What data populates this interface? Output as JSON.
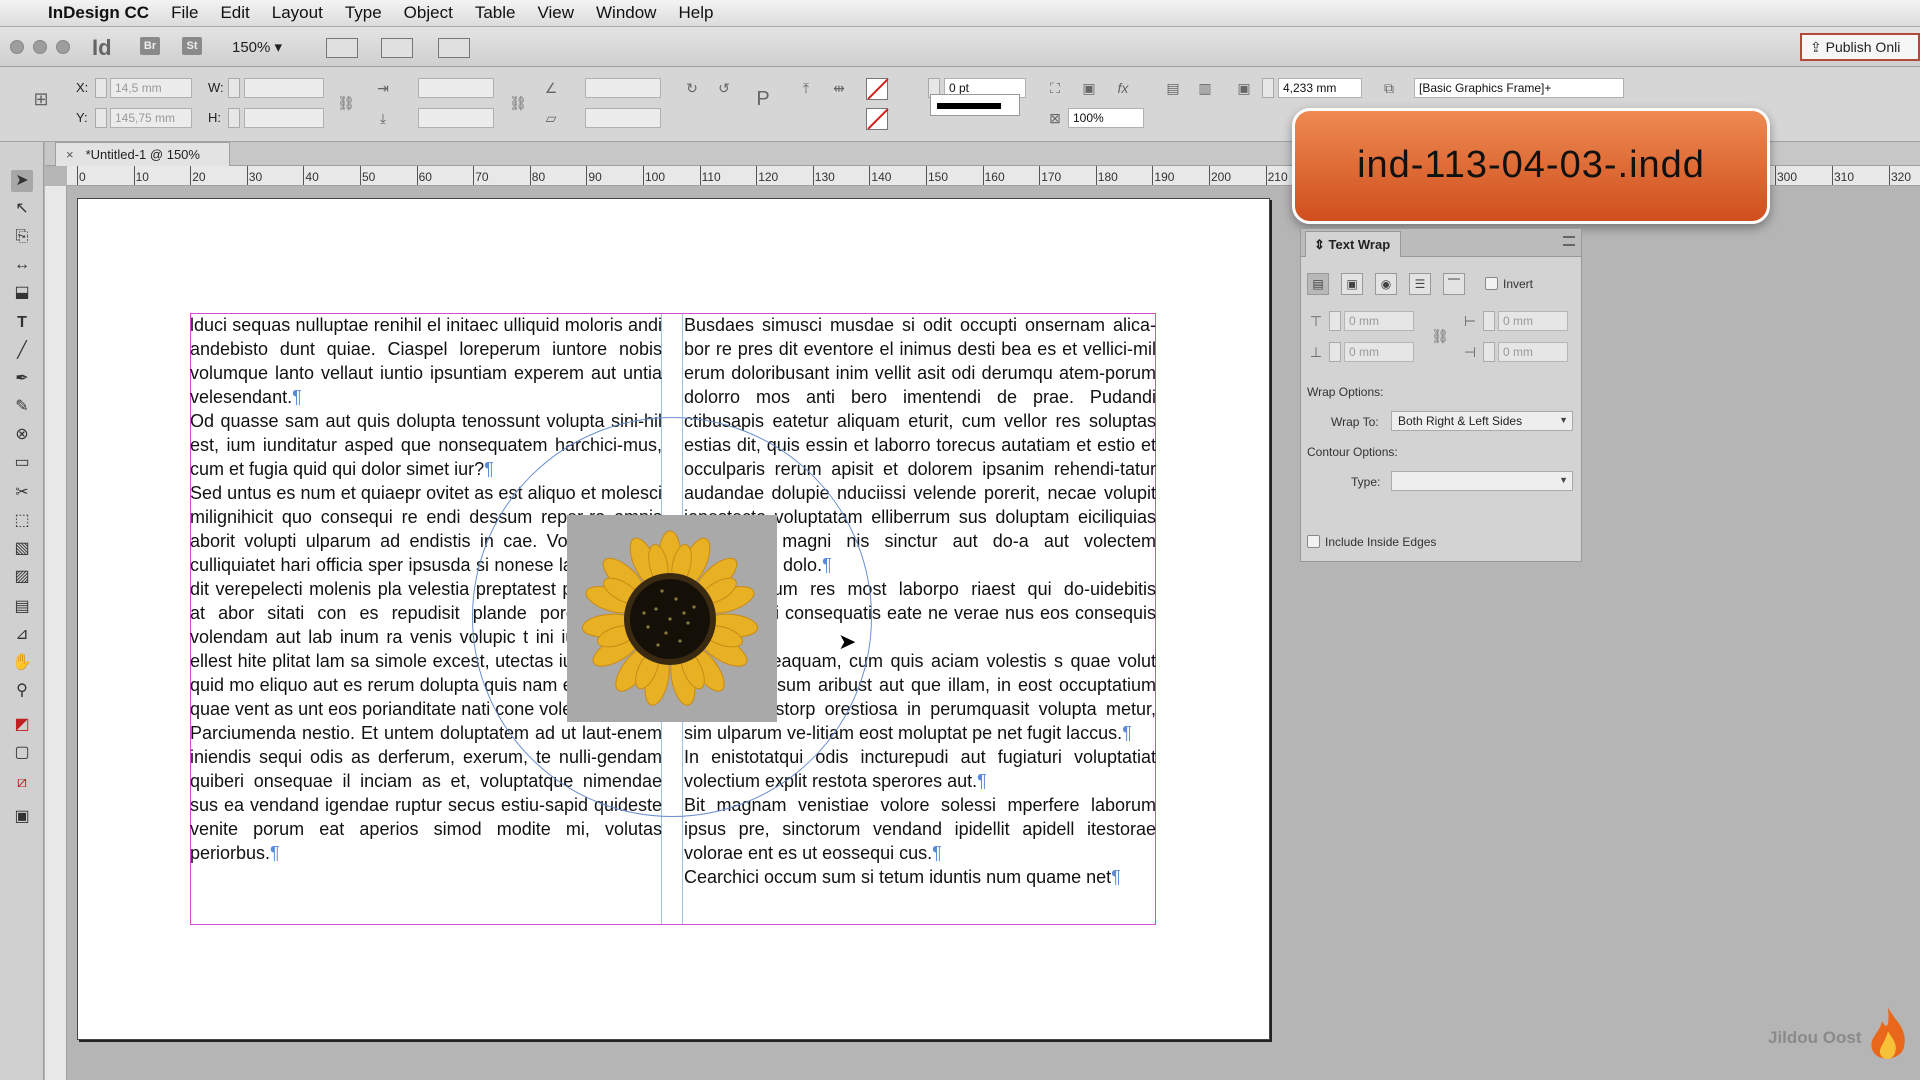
{
  "menubar": {
    "app_name": "InDesign CC",
    "items": [
      "File",
      "Edit",
      "Layout",
      "Type",
      "Object",
      "Table",
      "View",
      "Window",
      "Help"
    ]
  },
  "titlebar": {
    "app_badge": "Id",
    "bridge_label": "Br",
    "stock_label": "St",
    "zoom": "150%",
    "publish_label": "Publish Onli"
  },
  "control": {
    "x_label": "X:",
    "x_value": "14,5 mm",
    "y_label": "Y:",
    "y_value": "145,75 mm",
    "w_label": "W:",
    "h_label": "H:",
    "stroke_weight": "0 pt",
    "opacity": "100%",
    "frame_size": "4,233 mm",
    "object_style": "[Basic Graphics Frame]+"
  },
  "document": {
    "tab_title": "*Untitled-1 @ 150%",
    "ruler_marks": [
      "0",
      "10",
      "20",
      "30",
      "40",
      "50",
      "60",
      "70",
      "80",
      "90",
      "100",
      "110",
      "120",
      "130",
      "140",
      "150",
      "160",
      "170",
      "180",
      "190",
      "200",
      "210",
      "300",
      "310",
      "320"
    ],
    "col1_paragraphs": [
      "lduci sequas nulluptae renihil el initaec ulliquid moloris andi andebisto dunt quiae. Ciaspel loreperum iuntore nobis volumque lanto vellaut iuntio ipsuntiam experem aut untia velesendant.",
      "Od quasse sam aut quis dolupta tenossunt volupta sini-hil est, ium iunditatur asped que nonsequatem harchici-mus, cum et fugia quid qui dolor simet iur?",
      "Sed untus es num et quiaepr ovitet as est aliquo et molesci milignihicit quo consequi re endi dessum reper-ro omnis aborit volupti ulparum ad endistis in cae. Voluptus milit, culliquiatet hari officia sper ipsusda si nonese laboraesedio dit verepelecti molenis pla velestia preptatest pratis arciae at abor sitati con es repudisit plande poressimu pro volendam aut lab inum ra venis volupic t ini iunt adigend ellest hite plitat lam sa simole excest, utectas iust, sin pore quid mo eliquo aut es rerum dolupta quis nam escissi tatur, quae vent as unt eos porianditate nati cone volectur?",
      "Parciumenda nestio. Et untem doluptatem ad ut laut-enem iniendis sequi odis as derferum, exerum, te nulli-gendam quiberi onsequae il inciam as et, voluptatque nimendae sus ea vendand igendae ruptur secus estiu-sapid quideste venite porum eat aperios simod modite mi, volutas periorbus."
    ],
    "col2_paragraphs": [
      "Busdaes simusci musdae si odit occupti onsernam alica-bor re pres dit eventore el inimus desti bea es et vellici-mil erum doloribusant inim vellit asit odi derumqu atem-porum dolorro mos anti bero imentendi de prae. Pudandi ctibusapis eatetur aliquam eturit, cum vellor res soluptas estias dit, quis essin et laborro torecus autatiam et estio et occulparis rerum apisit et dolorem ipsanim rehendi-tatur audandae dolupie nduciissi velende porerit, necae volupit ionestecto voluptatam elliberrum sus doluptam eiciliquias et litaquo magni nis sinctur aut do-a aut volectem vollaborrum dolo.",
      "ost et verum res most laborpo riaest qui do-uidebitis estiore prati consequatis eate ne verae nus eos consequis etur?",
      "solupienis eaquam, cum quis aciam volestis s quae volut modia que sum aribust aut que illam, in eost occuptatium alibusa mustorp orestiosa in perumquasit volupta metur, sim ulparum ve-litiam eost moluptat pe net fugit laccus.",
      "In enistotatqui odis incturepudi aut fugiaturi voluptatiat volectium explit restota sperores aut.",
      "Bit magnam venistiae volore solessi mperfere laborum ipsus pre, sinctorum vendand ipidellit apidell itestorae volorae ent es ut eossequi cus.",
      "Cearchici occum sum si tetum iduntis num quame net"
    ]
  },
  "overlay": {
    "file_name": "ind-113-04-03-.indd"
  },
  "text_wrap_panel": {
    "title": "Text Wrap",
    "invert_label": "Invert",
    "offset_top": "0 mm",
    "offset_bottom": "0 mm",
    "offset_left": "0 mm",
    "offset_right": "0 mm",
    "wrap_options_label": "Wrap Options:",
    "wrap_to_label": "Wrap To:",
    "wrap_to_value": "Both Right & Left Sides",
    "contour_options_label": "Contour Options:",
    "type_label": "Type:",
    "type_value": "",
    "include_inside_edges_label": "Include Inside Edges"
  },
  "watermark": {
    "text": "Jildou Oost"
  }
}
